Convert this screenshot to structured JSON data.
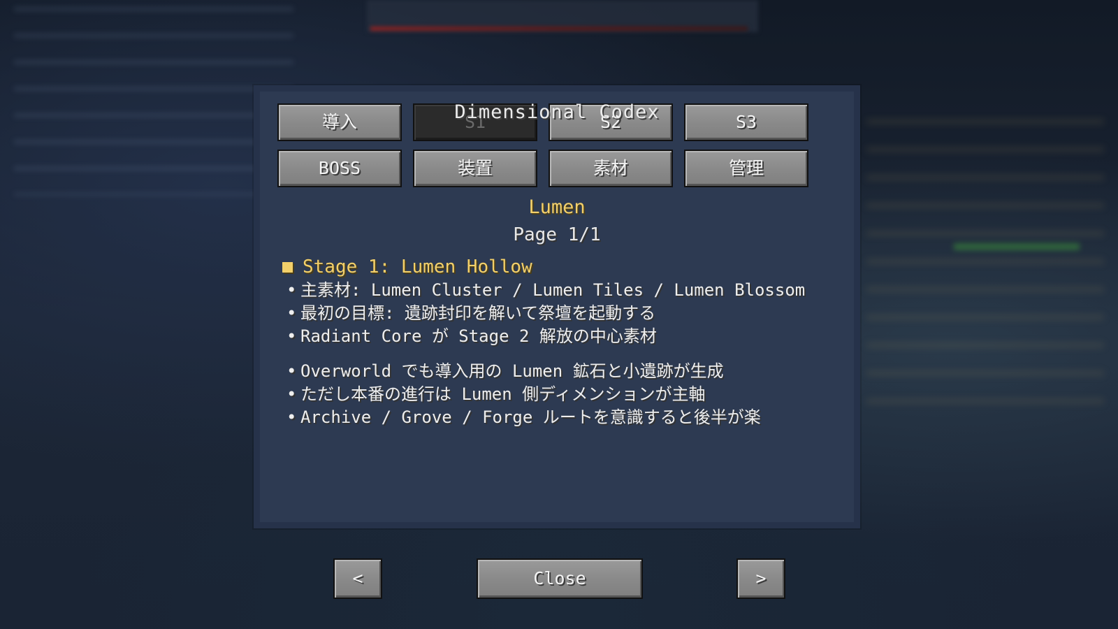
{
  "window": {
    "title": "Dimensional Codex"
  },
  "tabs": [
    {
      "label": "導入",
      "enabled": true
    },
    {
      "label": "S1",
      "enabled": false
    },
    {
      "label": "S2",
      "enabled": true
    },
    {
      "label": "S3",
      "enabled": true
    },
    {
      "label": "BOSS",
      "enabled": true
    },
    {
      "label": "装置",
      "enabled": true
    },
    {
      "label": "素材",
      "enabled": true
    },
    {
      "label": "管理",
      "enabled": true
    }
  ],
  "page": {
    "heading": "Lumen",
    "page_indicator": "Page 1/1",
    "stage_title": "Stage 1: Lumen Hollow",
    "bullet_marker": "•",
    "section1": [
      "主素材: Lumen Cluster / Lumen Tiles / Lumen Blossom",
      "最初の目標: 遺跡封印を解いて祭壇を起動する",
      "Radiant Core が Stage 2 解放の中心素材"
    ],
    "section2": [
      "Overworld でも導入用の Lumen 鉱石と小遺跡が生成",
      "ただし本番の進行は Lumen 側ディメンションが主軸",
      "Archive / Grove / Forge ルートを意識すると後半が楽"
    ]
  },
  "footer": {
    "prev_label": "<",
    "close_label": "Close",
    "next_label": ">"
  },
  "colors": {
    "panel_bg": "#2d3a52",
    "heading_gold": "#f3d06a",
    "button_gray": "#8a8a8a",
    "button_disabled": "#2b2b2b"
  }
}
